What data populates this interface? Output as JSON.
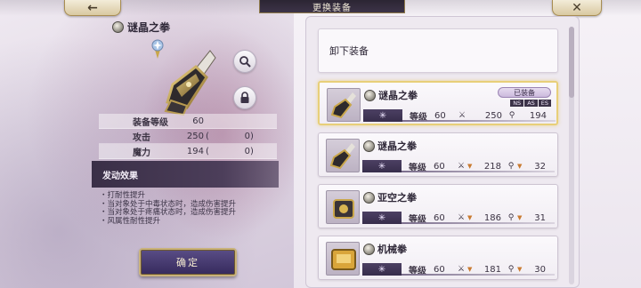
{
  "header": {
    "back_icon": "←",
    "title": "更换装备",
    "close_icon": "✕"
  },
  "detail": {
    "name": "谜晶之拳",
    "stats": [
      {
        "label": "装备等级",
        "value": "60",
        "open": "",
        "extra": "",
        "close": ""
      },
      {
        "label": "攻击",
        "value": "250",
        "open": "(",
        "extra": "0",
        "close": ")"
      },
      {
        "label": "魔力",
        "value": "194",
        "open": "(",
        "extra": "0",
        "close": ")"
      }
    ],
    "effect_title": "发动效果",
    "effects": [
      "・打耐性提升",
      "・当对象处于中毒状态时，造成伤害提升",
      "・当对象处于疼痛状态时，造成伤害提升",
      "・风属性耐性提升"
    ],
    "confirm_label": "确定"
  },
  "list": {
    "unequip_label": "卸下装备",
    "items": [
      {
        "name": "谜晶之拳",
        "level_label": "等级",
        "level": "60",
        "atk": "250",
        "mag": "194",
        "equipped": true,
        "equipped_label": "已装备",
        "tags": [
          "NS",
          "AS",
          "ES"
        ],
        "atk_arrow": "",
        "mag_arrow": ""
      },
      {
        "name": "谜晶之拳",
        "level_label": "等级",
        "level": "60",
        "atk": "218",
        "mag": "32",
        "equipped": false,
        "atk_arrow": "▼",
        "mag_arrow": "▼"
      },
      {
        "name": "亚空之拳",
        "level_label": "等级",
        "level": "60",
        "atk": "186",
        "mag": "31",
        "equipped": false,
        "atk_arrow": "▼",
        "mag_arrow": "▼"
      },
      {
        "name": "机械拳",
        "level_label": "等级",
        "level": "60",
        "atk": "181",
        "mag": "30",
        "equipped": false,
        "atk_arrow": "▼",
        "mag_arrow": "▼"
      }
    ]
  },
  "colors": {
    "accent_gold": "#e8cf79",
    "dark_panel": "#3a2f47",
    "arrow_down": "#c97a2f"
  }
}
